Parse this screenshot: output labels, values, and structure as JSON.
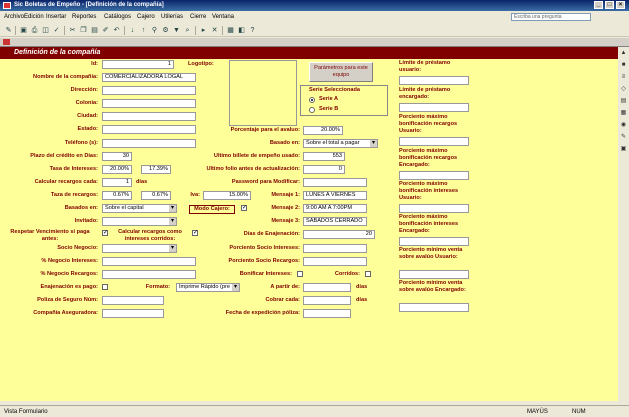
{
  "window": {
    "title": "Sic Boletas de Empeño - [Definición de la compañía]"
  },
  "menu": [
    "Archivo",
    "Edición",
    "Insertar",
    "Reportes",
    "Catálogos",
    "Cajero",
    "Utilerías",
    "Cierre",
    "Ventana"
  ],
  "help_placeholder": "Escriba una pregunta",
  "form": {
    "header": "Definición de la compañía",
    "id_label": "Id:",
    "id_value": "1",
    "logotipo_label": "Logotipo:",
    "param_button": "Parámetros para este equipo",
    "serie_title": "Serie Seleccionada",
    "serie_a": "Serie A",
    "serie_b": "Serie B",
    "nombre_label": "Nombre de la compañía:",
    "nombre_value": "COMERCIALIZADORA LOGAL",
    "direccion_label": "Dirección:",
    "colonia_label": "Colonia:",
    "ciudad_label": "Ciudad:",
    "estado_label": "Estado:",
    "telefono_label": "Teléfono (s):",
    "porcentaje_label": "Porcentaje para el avaluo:",
    "porcentaje_value": "20.00%",
    "basado_label": "Basado en:",
    "basado_value": "Sobre el total a pagar",
    "plazo_label": "Plazo del crédito en Días:",
    "plazo_value": "30",
    "ultimo_billete_label": "Ultimo billete de empeño usado:",
    "ultimo_billete_value": "553",
    "tasa_label": "Tasa de Intereses:",
    "tasa_value1": "20.00%",
    "tasa_value2": "17.39%",
    "folio_label": "Ultimo folio antes de actualización:",
    "folio_value": "0",
    "calc_label": "Calcular recargos cada:",
    "calc_value": "1",
    "calc_unit": "días",
    "password_label": "Password para Modificar:",
    "tasa_rec_label": "Taza de recargos:",
    "tasa_rec_value1": "0.67%",
    "tasa_rec_value2": "0.67%",
    "iva_label": "Iva:",
    "iva_value": "15.00%",
    "mensaje1_label": "Mensaje 1:",
    "mensaje1_value": "LUNES A VIERNES",
    "basados_label": "Basados en:",
    "basados_value": "Sobre el capital",
    "modo_cajero_label": "Modo Cajero:",
    "modo_cajero_check": "✓",
    "mensaje2_label": "Mensaje 2:",
    "mensaje2_value": "9:00 AM A 7:00PM",
    "invitado_label": "Invitado:",
    "mensaje3_label": "Mensaje 3:",
    "mensaje3_value": "SABADOS CERRADO",
    "respetar_label": "Respetar Vencimiento si paga antes:",
    "respetar_check": "✓",
    "calc_rec_label": "Calcular recargos como intereses corridos:",
    "calc_rec_check": "✓",
    "dias_enaj_label": "Días de Enajenación:",
    "dias_enaj_value": "20",
    "socio_neg_label": "Socio Negocio:",
    "porc_socio_int_label": "Porciento Socio Intereses:",
    "pct_neg_int_label": "% Negocio Intereses:",
    "porc_socio_rec_label": "Porciento Socio Recargos:",
    "pct_neg_rec_label": "% Negocio Recargos:",
    "bonificar_label": "Bonificar Intereses:",
    "corridos_label": "Corridos:",
    "enaj_pago_label": "Enajenación es pago:",
    "formato_label": "Formato:",
    "formato_value": "Imprime Rápido (pre",
    "a_partir_label": "A partir de:",
    "dias1": "días",
    "poliza_label": "Poliza de Seguro Núm:",
    "cobrar_label": "Cobrar cada:",
    "dias2": "días",
    "aseg_label": "Compañía Aseguradora:",
    "fecha_exp_label": "Fecha de expedición póliza:",
    "right_labels": [
      "Límite de préstamo usuario:",
      "Límite de préstamo encargado:",
      "Porciento máximo bonificación recargos Usuario:",
      "Porciento máximo bonificación recargos Encargado:",
      "Porciento máximo bonificación intereses Usuario:",
      "Porciento máximo bonificación intereses Encargado:",
      "Porciento mínimo venta sobre avalúo Usuario:",
      "Porciento mínimo venta sobre avalúo Encargado:"
    ]
  },
  "status": {
    "left": "Vista Formulario",
    "mayus": "MAYÚS",
    "num": "NUM"
  }
}
